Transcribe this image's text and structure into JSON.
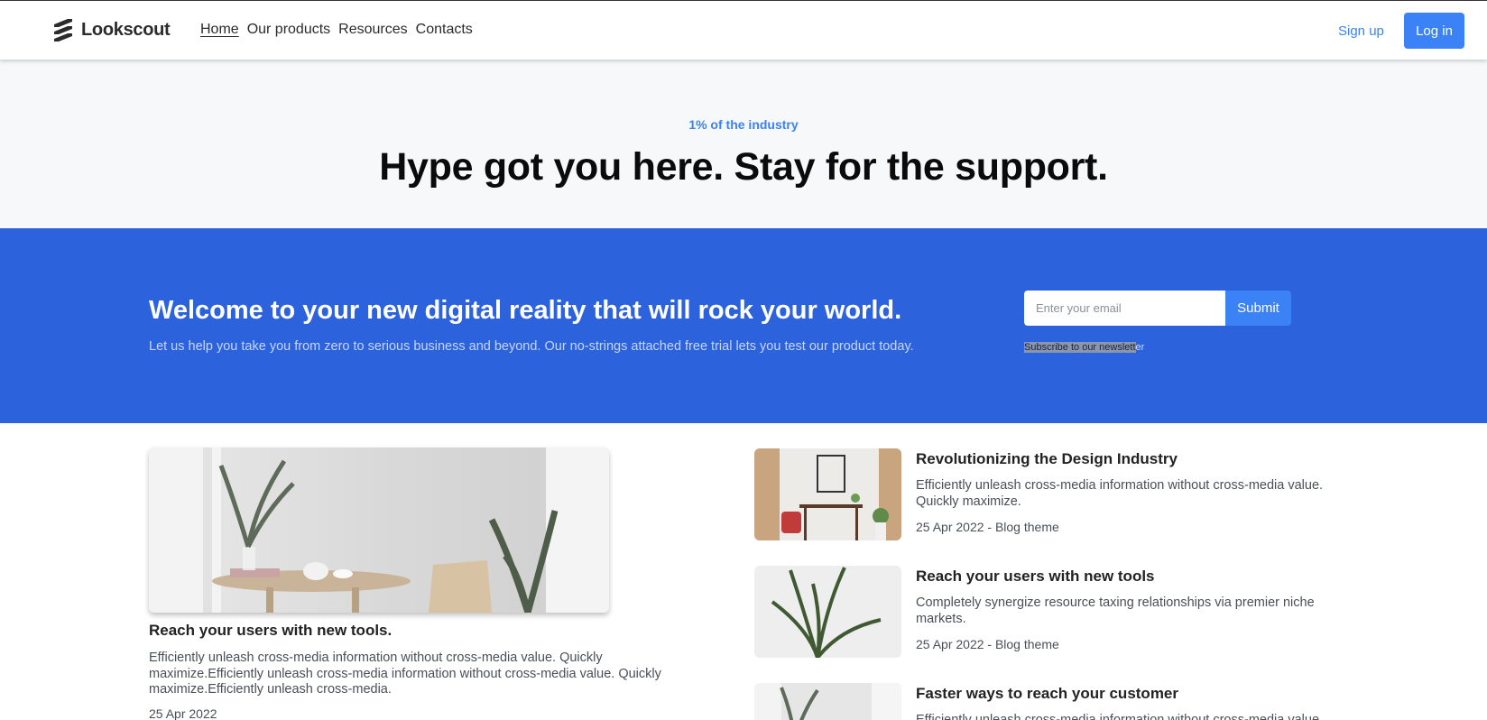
{
  "header": {
    "logo_text": "Lookscout",
    "logo_icon": "stacked-bars-logo-icon",
    "nav": [
      {
        "label": "Home",
        "active": true
      },
      {
        "label": "Our products",
        "active": false
      },
      {
        "label": "Resources",
        "active": false
      },
      {
        "label": "Contacts",
        "active": false
      }
    ],
    "signup_label": "Sign up",
    "login_label": "Log in"
  },
  "hero": {
    "eyebrow": "1% of the industry",
    "title": "Hype got you here. Stay for the support."
  },
  "banner": {
    "title": "Welcome to your new digital reality that will rock your world.",
    "subtitle": "Let us help you take you from zero to serious business and beyond. Our no-strings attached free trial lets you test our product today.",
    "email_placeholder": "Enter your email",
    "submit_label": "Submit",
    "newsletter_selected": "Subscribe to our newslett",
    "newsletter_rest": "er"
  },
  "feature": {
    "title": "Reach your users with new tools.",
    "text": "Efficiently unleash cross-media information without cross-media value. Quickly maximize.Efficiently unleash cross-media information without cross-media value. Quickly maximize.Efficiently unleash cross-media.",
    "date": "25 Apr 2022"
  },
  "posts": [
    {
      "title": "Revolutionizing the Design Industry",
      "text": "Efficiently unleash cross-media information without cross-media value. Quickly maximize.",
      "meta": "25 Apr 2022 - Blog theme"
    },
    {
      "title": "Reach your users with new tools",
      "text": "Completely synergize resource taxing relationships via premier niche markets.",
      "meta": "25 Apr 2022 - Blog theme"
    },
    {
      "title": "Faster ways to reach your customer",
      "text": "Efficiently unleash cross-media information without cross-media value."
    }
  ],
  "colors": {
    "accent": "#3b82f6",
    "banner_bg": "#2c63dc",
    "hero_bg": "#f7f8fa"
  }
}
